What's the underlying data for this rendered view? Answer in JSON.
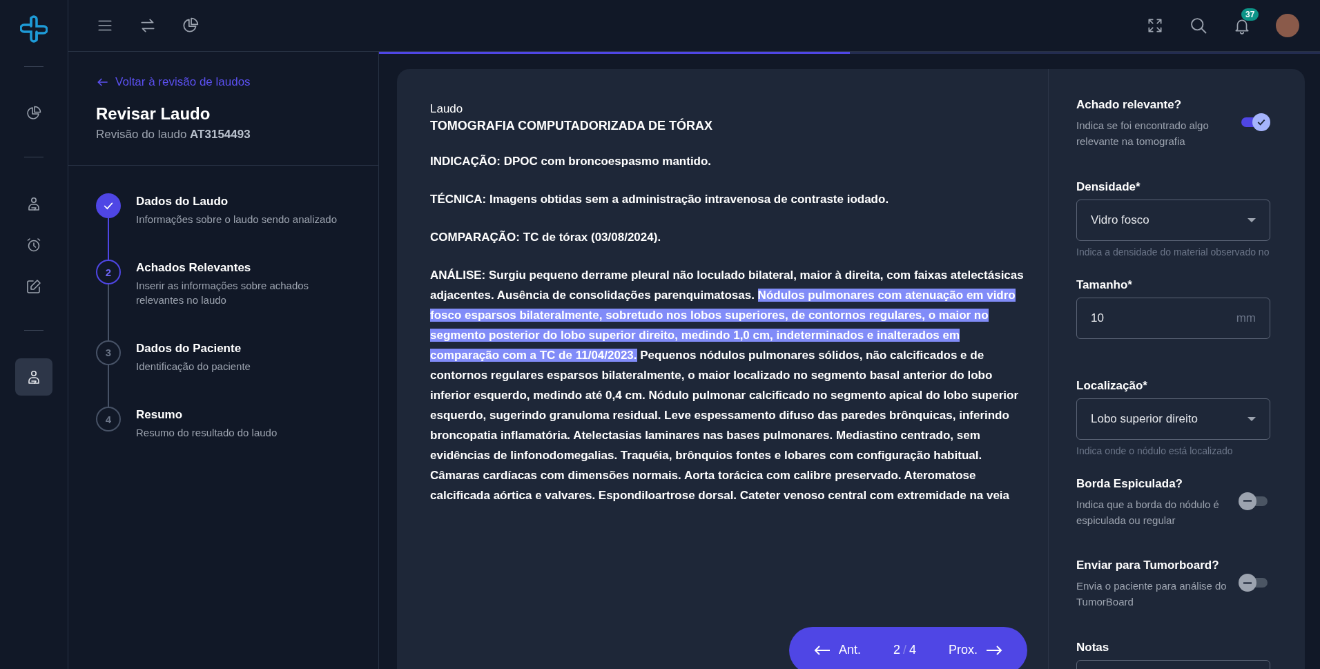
{
  "rail": [
    {
      "kind": "chart",
      "selected": false
    },
    {
      "kind": "person",
      "selected": false
    },
    {
      "kind": "alarm",
      "selected": false
    },
    {
      "kind": "edit",
      "selected": false
    },
    {
      "kind": "person",
      "selected": true
    }
  ],
  "topbar": {
    "notifications": "37"
  },
  "progress": {
    "level": 0.5
  },
  "review": {
    "back_link": "Voltar à revisão de laudos",
    "title": "Revisar Laudo",
    "subtitle": "Revisão do laudo **AT3154493**"
  },
  "steps": [
    {
      "kind": "done",
      "title": "Dados do Laudo",
      "description": "Informações sobre o laudo sendo analizado"
    },
    {
      "number": "2",
      "kind": "current",
      "title": "Achados Relevantes",
      "description": "Inserir as informações sobre achados relevantes no laudo"
    },
    {
      "number": "3",
      "kind": "pending",
      "title": "Dados do Paciente",
      "description": "Identificação do paciente"
    },
    {
      "number": "4",
      "kind": "pending",
      "title": "Resumo",
      "description": "Resumo do resultado do laudo"
    }
  ],
  "report": {
    "label": "Laudo",
    "title": "TOMOGRAFIA COMPUTADORIZADA DE TÓRAX",
    "paragraphs": [
      [
        {
          "text": "INDICAÇÃO: DPOC com broncoespasmo mantido.",
          "highlighted": false
        }
      ],
      [
        {
          "text": "TÉCNICA: Imagens obtidas sem a administração intravenosa de contraste iodado.",
          "highlighted": false
        }
      ],
      [
        {
          "text": "COMPARAÇÃO: TC de tórax (03/08/2024).",
          "highlighted": false
        }
      ],
      [
        {
          "text": "ANÁLISE: Surgiu pequeno derrame pleural não loculado bilateral, maior à direita, com faixas atelectásicas adjacentes. Ausência de consolidações parenquimatosas. ",
          "highlighted": false
        },
        {
          "text": "Nódulos pulmonares com atenuação em vidro fosco esparsos bilateralmente, sobretudo nos lobos superiores, de contornos regulares, o maior no segmento posterior do lobo superior direito, medindo 1,0 cm, indeterminados e inalterados em comparação com a TC de 11/04/2023.",
          "highlighted": true
        },
        {
          "text": " Pequenos nódulos pulmonares sólidos, não calcificados e de contornos regulares esparsos bilateralmente, o maior localizado no segmento basal anterior do lobo inferior esquerdo, medindo até 0,4 cm. Nódulo pulmonar calcificado no segmento apical do lobo superior esquerdo, sugerindo granuloma residual. Leve espessamento difuso das paredes brônquicas, inferindo broncopatia inflamatória. Atelectasias laminares nas bases pulmonares. Mediastino centrado, sem evidências de linfonodomegalias. Traquéia, brônquios fontes e lobares com configuração habitual. Câmaras cardíacas com dimensões normais. Aorta torácica com calibre preservado. Ateromatose calcificada aórtica e valvares. Espondiloartrose dorsal. Cateter venoso central com extremidade na veia",
          "highlighted": false
        }
      ]
    ]
  },
  "pager": {
    "previous": "Ant.",
    "current": "2",
    "separator": "/",
    "total": "4",
    "next": "Prox."
  },
  "form": [
    {
      "kind": "toggle",
      "label": "Achado relevante?",
      "description": "Indica se foi encontrado algo relevante na tomografia",
      "on": true
    },
    {
      "kind": "select",
      "label": "Densidade*",
      "value": "Vidro fosco",
      "hint": "Indica a densidade do material observado no"
    },
    {
      "kind": "input",
      "label": "Tamanho*",
      "value": "10",
      "suffix": "mm"
    },
    {
      "kind": "select",
      "label": "Localização*",
      "value": "Lobo superior direito",
      "hint": "Indica onde o nódulo está localizado"
    },
    {
      "kind": "toggle",
      "label": "Borda Espiculada?",
      "description": "Indica que a borda do nódulo é espiculada ou regular",
      "on": false
    },
    {
      "kind": "toggle",
      "label": "Enviar para Tumorboard?",
      "description": "Envia o paciente para análise do TumorBoard",
      "on": false
    },
    {
      "kind": "textarea",
      "label": "Notas"
    }
  ]
}
